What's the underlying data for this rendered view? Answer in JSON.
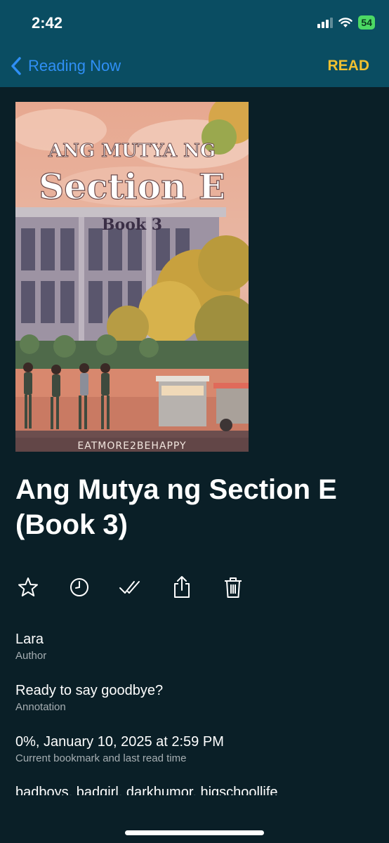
{
  "status_bar": {
    "time": "2:42",
    "battery": "54"
  },
  "nav": {
    "back_label": "Reading Now",
    "action_label": "READ"
  },
  "cover": {
    "line1": "ANG MUTYA NG",
    "line2": "Section E",
    "line3": "Book 3",
    "author_line": "EATMORE2BEHAPPY"
  },
  "book": {
    "title": "Ang Mutya ng Section E (Book 3)"
  },
  "actions": [
    {
      "name": "favorite",
      "icon": "star-icon"
    },
    {
      "name": "history",
      "icon": "clock-icon"
    },
    {
      "name": "mark-read",
      "icon": "double-check-icon"
    },
    {
      "name": "share",
      "icon": "share-icon"
    },
    {
      "name": "delete",
      "icon": "trash-icon"
    }
  ],
  "details": {
    "author": {
      "value": "Lara",
      "label": "Author"
    },
    "annotation": {
      "value": "Ready to say goodbye?",
      "label": "Annotation"
    },
    "bookmark": {
      "value": "0%, January 10, 2025 at 2:59 PM",
      "label": "Current bookmark and last read time"
    },
    "tags": "badboys, badgirl, darkhumor, higschoollife"
  },
  "colors": {
    "header": "#0a4d62",
    "background": "#0a1f27",
    "accent_link": "#2f8ff5",
    "read_button": "#f0c030",
    "secondary_text": "#a6aeb2"
  }
}
